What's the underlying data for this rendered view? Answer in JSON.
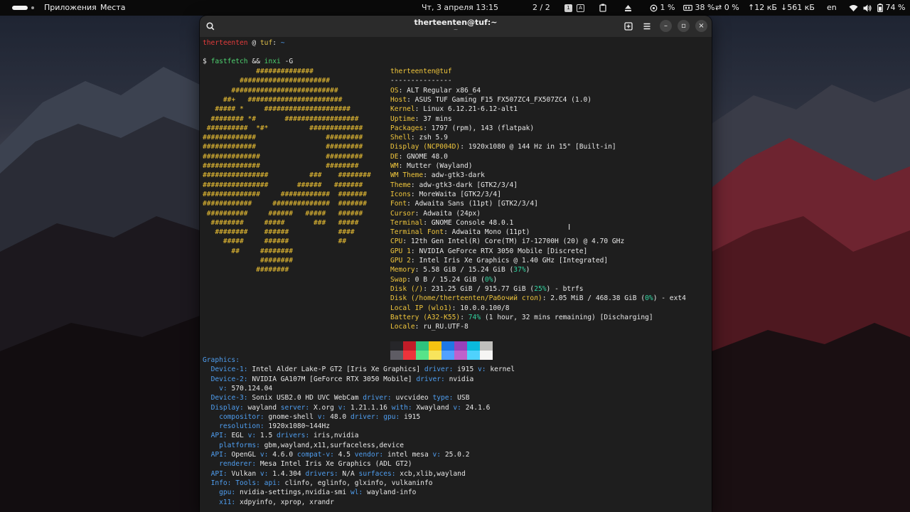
{
  "topbar": {
    "apps": "Приложения",
    "places": "Места",
    "datetime": "Чт, 3 апреля 13:15",
    "workspaces": "2 / 2",
    "cpu": "1 %",
    "memory": "38 %",
    "swap": "0 %",
    "upload": "12 кБ",
    "download": "561 кБ",
    "language": "en",
    "battery": "74 %"
  },
  "window": {
    "title": "therteenten@tuf:~",
    "subtitle": "~"
  },
  "prompt": {
    "user": "therteenten",
    "at": "@",
    "host": "tuf",
    "sep": ":",
    "path": "~"
  },
  "command": {
    "sign": "$",
    "part1": "fastfetch",
    "part2": "&&",
    "part3": "inxi",
    "part4": "-G"
  },
  "logo_lines": [
    "             ##############",
    "         ######################",
    "       ##########################",
    "     ##+   #######################",
    "   ##### *     #####################",
    "  ######## *#       ##################",
    " ##########  *#*          #############",
    "#############                 #########",
    "#############                 #########",
    "##############                #########",
    "##############                ########",
    "################          ###    ########",
    "################       ######   #######",
    "##############     ############  #######",
    "############     ##############  #######",
    " ##########     ######   #####   ######",
    "  ########     #####       ###   #####",
    "   ########    ######            ####",
    "     #####     ######            ##",
    "       ##     ########",
    "              ########",
    "             ########"
  ],
  "fetch": {
    "user": "therteenten",
    "host": "tuf",
    "separator": "---------------",
    "rows": [
      {
        "k": "OS",
        "v": "ALT Regular x86_64"
      },
      {
        "k": "Host",
        "v": "ASUS TUF Gaming F15 FX507ZC4_FX507ZC4 (1.0)"
      },
      {
        "k": "Kernel",
        "v": "Linux 6.12.21-6.12-alt1"
      },
      {
        "k": "Uptime",
        "v": "37 mins"
      },
      {
        "k": "Packages",
        "v": "1797 (rpm), 143 (flatpak)"
      },
      {
        "k": "Shell",
        "v": "zsh 5.9"
      },
      {
        "k": "Display (NCP004D)",
        "v": "1920x1080 @ 144 Hz in 15\" [Built-in]"
      },
      {
        "k": "DE",
        "v": "GNOME 48.0"
      },
      {
        "k": "WM",
        "v": "Mutter (Wayland)"
      },
      {
        "k": "WM Theme",
        "v": "adw-gtk3-dark"
      },
      {
        "k": "Theme",
        "v": "adw-gtk3-dark [GTK2/3/4]"
      },
      {
        "k": "Icons",
        "v": "MoreWaita [GTK2/3/4]"
      },
      {
        "k": "Font",
        "v": "Adwaita Sans (11pt) [GTK2/3/4]"
      },
      {
        "k": "Cursor",
        "v": "Adwaita (24px)"
      },
      {
        "k": "Terminal",
        "v": "GNOME Console 48.0.1"
      },
      {
        "k": "Terminal Font",
        "v": "Adwaita Mono (11pt)"
      },
      {
        "k": "CPU",
        "v": "12th Gen Intel(R) Core(TM) i7-12700H (20) @ 4.70 GHz"
      },
      {
        "k": "GPU 1",
        "v": "NVIDIA GeForce RTX 3050 Mobile [Discrete]"
      },
      {
        "k": "GPU 2",
        "v": "Intel Iris Xe Graphics @ 1.40 GHz [Integrated]"
      },
      {
        "k": "Memory",
        "v": "5.58 GiB / 15.24 GiB (",
        "p": "37%",
        "t": ")"
      },
      {
        "k": "Swap",
        "v": "0 B / 15.24 GiB (",
        "p": "0%",
        "t": ")"
      },
      {
        "k": "Disk (/)",
        "v": "231.25 GiB / 915.77 GiB (",
        "p": "25%",
        "t": ") - btrfs"
      },
      {
        "k": "Disk (/home/therteenten/Рабочий стол)",
        "v": "2.05 MiB / 468.38 GiB (",
        "p": "0%",
        "t": ") - ext4"
      },
      {
        "k": "Local IP (wlo1)",
        "v": "10.0.0.100/8"
      },
      {
        "k": "Battery (A32-K55)",
        "v": "",
        "p": "74%",
        "t": " (1 hour, 32 mins remaining) [Discharging]"
      },
      {
        "k": "Locale",
        "v": "ru_RU.UTF-8"
      }
    ],
    "palette_top": [
      "#262629",
      "#c01c28",
      "#2ec27e",
      "#f5c211",
      "#1e78e4",
      "#9841bb",
      "#0ab9dc",
      "#c0bfbc"
    ],
    "palette_bottom": [
      "#5e5c64",
      "#ed333b",
      "#57e389",
      "#f8e45c",
      "#51a1ff",
      "#c061cb",
      "#4fd2fd",
      "#f6f5f4"
    ]
  },
  "inxi": [
    [
      [
        "blue",
        "Graphics:"
      ]
    ],
    [
      [
        "plain",
        "  "
      ],
      [
        "blue",
        "Device-1:"
      ],
      [
        "plain",
        " Intel Alder Lake-P GT2 [Iris Xe Graphics] "
      ],
      [
        "blue",
        "driver:"
      ],
      [
        "plain",
        " i915 "
      ],
      [
        "blue",
        "v:"
      ],
      [
        "plain",
        " kernel"
      ]
    ],
    [
      [
        "plain",
        "  "
      ],
      [
        "blue",
        "Device-2:"
      ],
      [
        "plain",
        " NVIDIA GA107M [GeForce RTX 3050 Mobile] "
      ],
      [
        "blue",
        "driver:"
      ],
      [
        "plain",
        " nvidia"
      ]
    ],
    [
      [
        "plain",
        "    "
      ],
      [
        "blue",
        "v:"
      ],
      [
        "plain",
        " 570.124.04"
      ]
    ],
    [
      [
        "plain",
        "  "
      ],
      [
        "blue",
        "Device-3:"
      ],
      [
        "plain",
        " Sonix USB2.0 HD UVC WebCam "
      ],
      [
        "blue",
        "driver:"
      ],
      [
        "plain",
        " uvcvideo "
      ],
      [
        "blue",
        "type:"
      ],
      [
        "plain",
        " USB"
      ]
    ],
    [
      [
        "plain",
        "  "
      ],
      [
        "blue",
        "Display:"
      ],
      [
        "plain",
        " wayland "
      ],
      [
        "blue",
        "server:"
      ],
      [
        "plain",
        " X.org "
      ],
      [
        "blue",
        "v:"
      ],
      [
        "plain",
        " 1.21.1.16 "
      ],
      [
        "blue",
        "with:"
      ],
      [
        "plain",
        " Xwayland "
      ],
      [
        "blue",
        "v:"
      ],
      [
        "plain",
        " 24.1.6"
      ]
    ],
    [
      [
        "plain",
        "    "
      ],
      [
        "blue",
        "compositor:"
      ],
      [
        "plain",
        " gnome-shell "
      ],
      [
        "blue",
        "v:"
      ],
      [
        "plain",
        " 48.0 "
      ],
      [
        "blue",
        "driver:"
      ],
      [
        "plain",
        " "
      ],
      [
        "blue",
        "gpu:"
      ],
      [
        "plain",
        " i915"
      ]
    ],
    [
      [
        "plain",
        "    "
      ],
      [
        "blue",
        "resolution:"
      ],
      [
        "plain",
        " 1920x1080~144Hz"
      ]
    ],
    [
      [
        "plain",
        "  "
      ],
      [
        "blue",
        "API:"
      ],
      [
        "plain",
        " EGL "
      ],
      [
        "blue",
        "v:"
      ],
      [
        "plain",
        " 1.5 "
      ],
      [
        "blue",
        "drivers:"
      ],
      [
        "plain",
        " iris,nvidia"
      ]
    ],
    [
      [
        "plain",
        "    "
      ],
      [
        "blue",
        "platforms:"
      ],
      [
        "plain",
        " gbm,wayland,x11,surfaceless,device"
      ]
    ],
    [
      [
        "plain",
        "  "
      ],
      [
        "blue",
        "API:"
      ],
      [
        "plain",
        " OpenGL "
      ],
      [
        "blue",
        "v:"
      ],
      [
        "plain",
        " 4.6.0 "
      ],
      [
        "blue",
        "compat-v:"
      ],
      [
        "plain",
        " 4.5 "
      ],
      [
        "blue",
        "vendor:"
      ],
      [
        "plain",
        " intel mesa "
      ],
      [
        "blue",
        "v:"
      ],
      [
        "plain",
        " 25.0.2"
      ]
    ],
    [
      [
        "plain",
        "    "
      ],
      [
        "blue",
        "renderer:"
      ],
      [
        "plain",
        " Mesa Intel Iris Xe Graphics (ADL GT2)"
      ]
    ],
    [
      [
        "plain",
        "  "
      ],
      [
        "blue",
        "API:"
      ],
      [
        "plain",
        " Vulkan "
      ],
      [
        "blue",
        "v:"
      ],
      [
        "plain",
        " 1.4.304 "
      ],
      [
        "blue",
        "drivers:"
      ],
      [
        "plain",
        " N/A "
      ],
      [
        "blue",
        "surfaces:"
      ],
      [
        "plain",
        " xcb,xlib,wayland"
      ]
    ],
    [
      [
        "plain",
        "  "
      ],
      [
        "blue",
        "Info:"
      ],
      [
        "plain",
        " "
      ],
      [
        "blue",
        "Tools:"
      ],
      [
        "plain",
        " "
      ],
      [
        "blue",
        "api:"
      ],
      [
        "plain",
        " clinfo, eglinfo, glxinfo, vulkaninfo"
      ]
    ],
    [
      [
        "plain",
        "    "
      ],
      [
        "blue",
        "gpu:"
      ],
      [
        "plain",
        " nvidia-settings,nvidia-smi "
      ],
      [
        "blue",
        "wl:"
      ],
      [
        "plain",
        " wayland-info"
      ]
    ],
    [
      [
        "plain",
        "    "
      ],
      [
        "blue",
        "x11:"
      ],
      [
        "plain",
        " xdpyinfo, xprop, xrandr"
      ]
    ]
  ],
  "colors": {
    "accent_user": "#e23b3b",
    "accent_host": "#e0c14a",
    "accent_command": "#4ed06f",
    "accent_key": "#f0c63c",
    "accent_inxi": "#4f9ef0"
  }
}
